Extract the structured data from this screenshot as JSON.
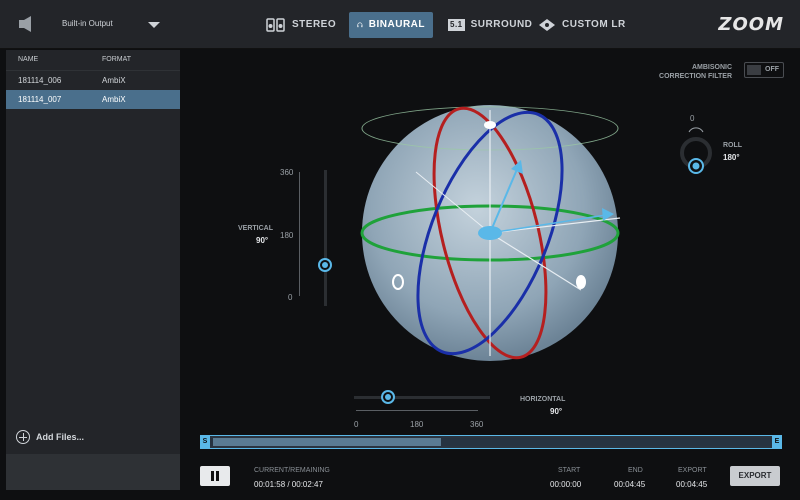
{
  "topbar": {
    "output_device": "Built-in Output",
    "tabs": [
      {
        "label": "STEREO",
        "icon": "stereo-icon",
        "active": false
      },
      {
        "label": "BINAURAL",
        "icon": "headphones-icon",
        "active": true
      },
      {
        "label": "SURROUND",
        "icon": "surround-51-icon",
        "badge": "5.1",
        "active": false
      },
      {
        "label": "CUSTOM LR",
        "icon": "custom-lr-icon",
        "active": false
      }
    ],
    "logo": "ZOOM"
  },
  "files": {
    "headers": {
      "name": "NAME",
      "format": "FORMAT"
    },
    "rows": [
      {
        "name": "181114_006",
        "format": "AmbiX",
        "selected": false
      },
      {
        "name": "181114_007",
        "format": "AmbiX",
        "selected": true
      }
    ],
    "add_label": "Add Files..."
  },
  "controls": {
    "ambisonic_filter": {
      "label_line1": "AMBISONIC",
      "label_line2": "CORRECTION FILTER",
      "state": "OFF"
    },
    "roll": {
      "label": "ROLL",
      "value": "180°",
      "dial_top": "0"
    },
    "vertical": {
      "label": "VERTICAL",
      "value": "90°",
      "ticks": [
        "360",
        "180",
        "0"
      ]
    },
    "horizontal": {
      "label": "HORIZONTAL",
      "value": "90°",
      "ticks": [
        "0",
        "180",
        "360"
      ]
    }
  },
  "timeline": {
    "start_marker": "S",
    "end_marker": "E",
    "progress_fraction": 0.41
  },
  "footer": {
    "current_label": "CURRENT/REMAINING",
    "current_value": "00:01:58 / 00:02:47",
    "start_label": "START",
    "start_value": "00:00:00",
    "end_label": "END",
    "end_value": "00:04:45",
    "export_label": "EXPORT",
    "export_value": "00:04:45",
    "export_button": "EXPORT"
  },
  "colors": {
    "accent": "#5ab8e8",
    "selected": "#4a6f8c",
    "ring_red": "#b51f1f",
    "ring_blue": "#1a2fa8",
    "ring_green": "#1fa23a"
  }
}
